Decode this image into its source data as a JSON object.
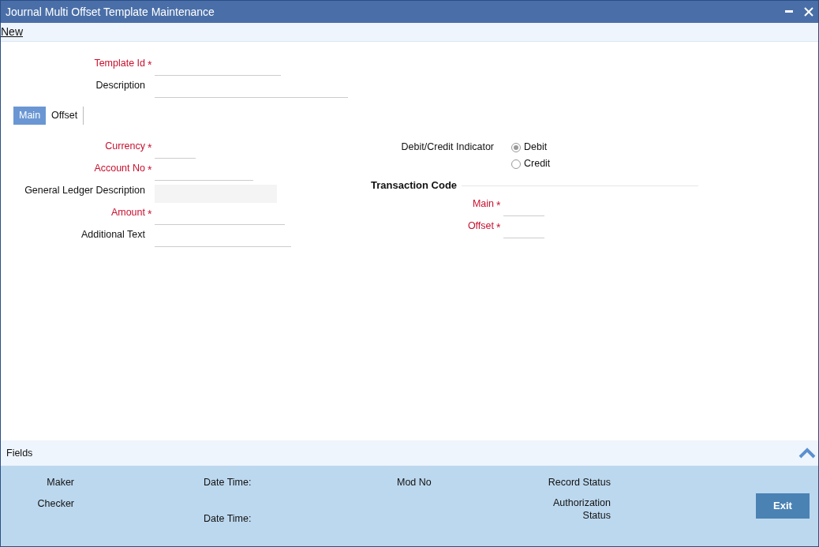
{
  "window": {
    "title": "Journal Multi Offset Template Maintenance"
  },
  "toolbar": {
    "actions": [
      "New"
    ]
  },
  "header_fields": [
    {
      "label": "Template Id",
      "required": true,
      "marker": "*",
      "disabled": false
    },
    {
      "label": "Description",
      "required": false,
      "disabled": false
    }
  ],
  "tabs": [
    {
      "label": "Main",
      "selected": true
    },
    {
      "label": "Offset",
      "selected": false
    }
  ],
  "main_fields": [
    {
      "label": "Currency",
      "required": true,
      "marker": "*",
      "disabled": false
    },
    {
      "label": "Account No",
      "required": true,
      "marker": "*",
      "disabled": false
    },
    {
      "label": "General Ledger Description",
      "required": false,
      "disabled": true
    },
    {
      "label": "Amount",
      "required": true,
      "marker": "*",
      "disabled": false
    },
    {
      "label": "Additional Text",
      "required": false,
      "disabled": false
    }
  ],
  "debit_credit": {
    "label": "Debit/Credit Indicator",
    "options": [
      {
        "label": "Debit",
        "selected": true
      },
      {
        "label": "Credit",
        "selected": false
      }
    ]
  },
  "transaction_code": {
    "title": "Transaction Code",
    "fields": [
      {
        "label": "Main",
        "required": true,
        "marker": "*",
        "disabled": false
      },
      {
        "label": "Offset",
        "required": true,
        "marker": "*",
        "disabled": false
      }
    ]
  },
  "fields_bar": {
    "label": "Fields"
  },
  "audit": {
    "maker": "Maker",
    "maker_date": "Date Time:",
    "mod_no": "Mod No",
    "record_status": "Record Status",
    "checker": "Checker",
    "checker_date": "Date Time:",
    "authorization_status": "Authorization Status"
  },
  "buttons": [
    "Exit"
  ]
}
